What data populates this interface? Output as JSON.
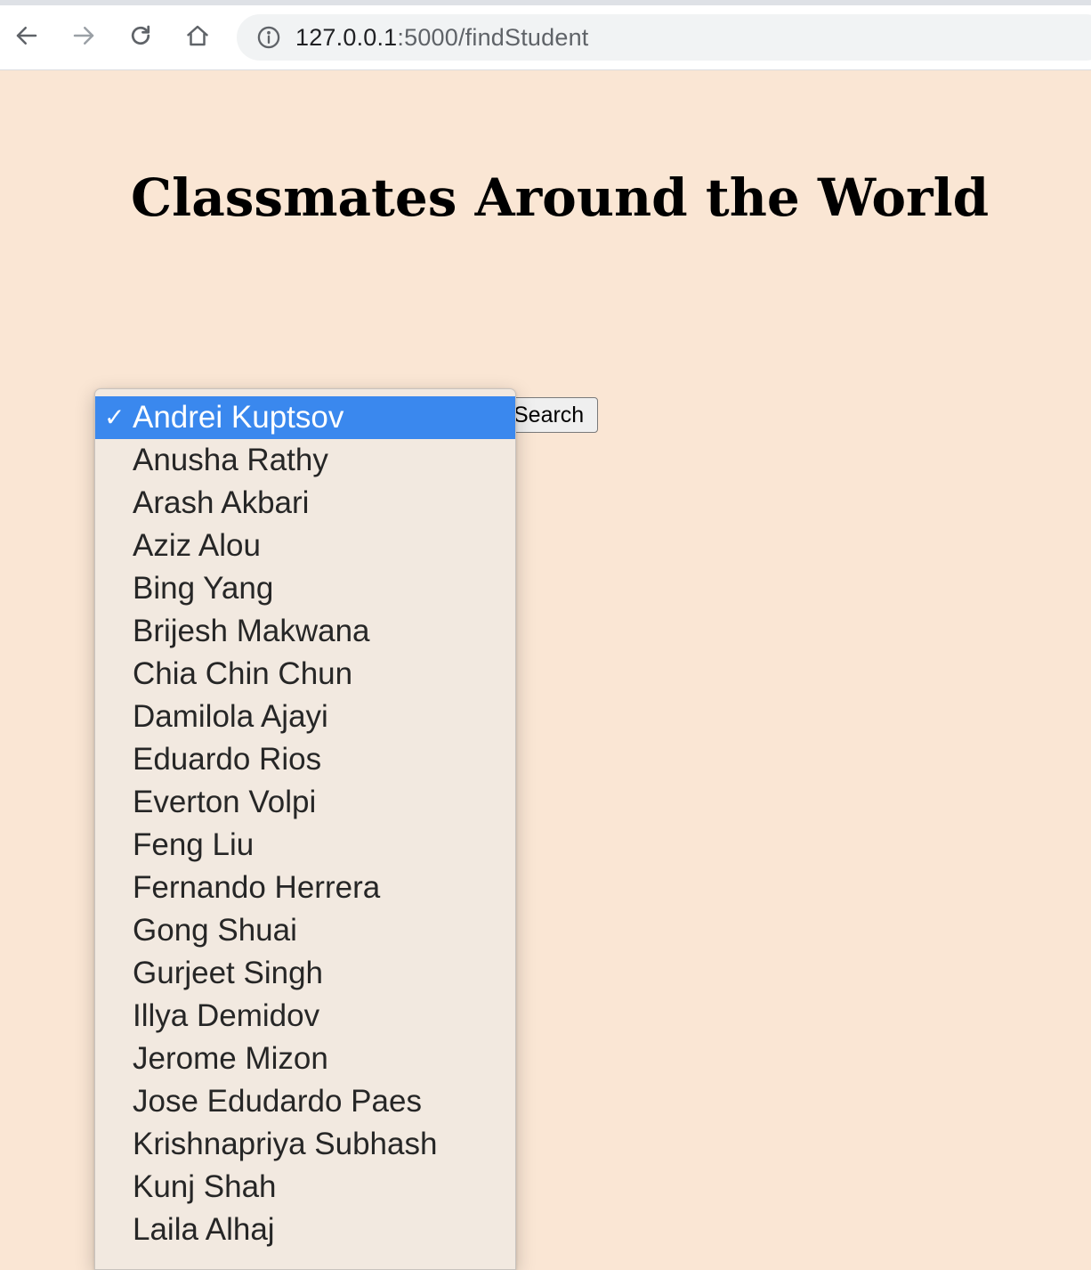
{
  "browser": {
    "url_host": "127.0.0.1",
    "url_path": ":5000/findStudent",
    "icons": {
      "back": "arrow-left-icon",
      "forward": "arrow-right-icon",
      "reload": "reload-icon",
      "home": "home-icon",
      "info": "info-icon"
    }
  },
  "page": {
    "title": "Classmates Around the World",
    "search_label": "Search",
    "background": "#fae6d4"
  },
  "dropdown": {
    "selected_mark": "✓",
    "selected_color": "#3a88ee",
    "options": [
      "Andrei Kuptsov",
      "Anusha Rathy",
      "Arash Akbari",
      "Aziz Alou",
      "Bing Yang",
      "Brijesh Makwana",
      "Chia Chin Chun",
      "Damilola Ajayi",
      "Eduardo Rios",
      "Everton Volpi",
      "Feng Liu",
      "Fernando Herrera",
      "Gong Shuai",
      "Gurjeet Singh",
      "Illya Demidov",
      "Jerome Mizon",
      "Jose Edudardo Paes",
      "Krishnapriya Subhash",
      "Kunj Shah",
      "Laila Alhaj"
    ]
  }
}
